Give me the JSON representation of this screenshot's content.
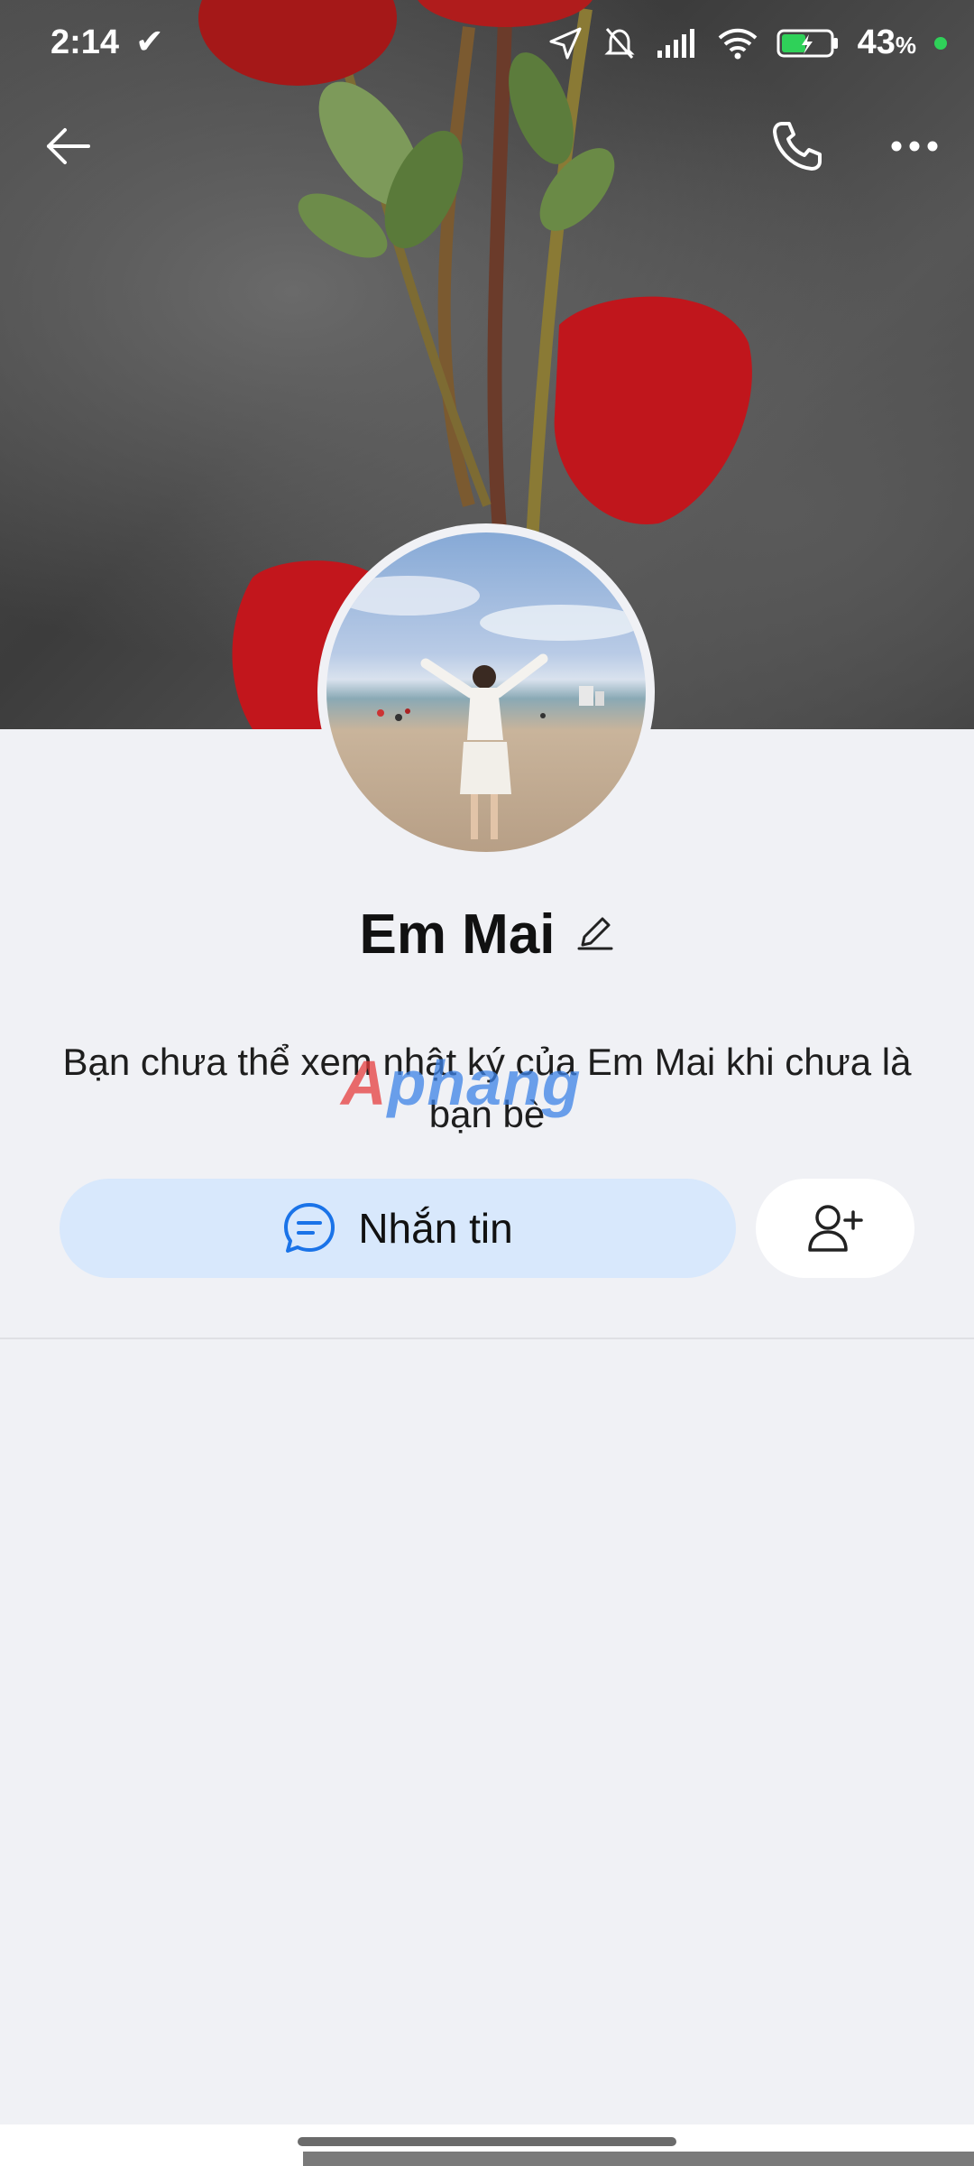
{
  "status_bar": {
    "time": "2:14",
    "battery": "43",
    "battery_unit": "%"
  },
  "profile": {
    "name": "Em Mai",
    "info_text": "Bạn chưa thể xem nhật ký của Em Mai khi chưa là bạn bè"
  },
  "actions": {
    "message_label": "Nhắn tin"
  },
  "watermark": {
    "prefix": "A",
    "rest": "phang"
  },
  "colors": {
    "accent": "#1a73e8",
    "message_button_bg": "#d8e8fc",
    "page_bg": "#f0f1f5"
  }
}
